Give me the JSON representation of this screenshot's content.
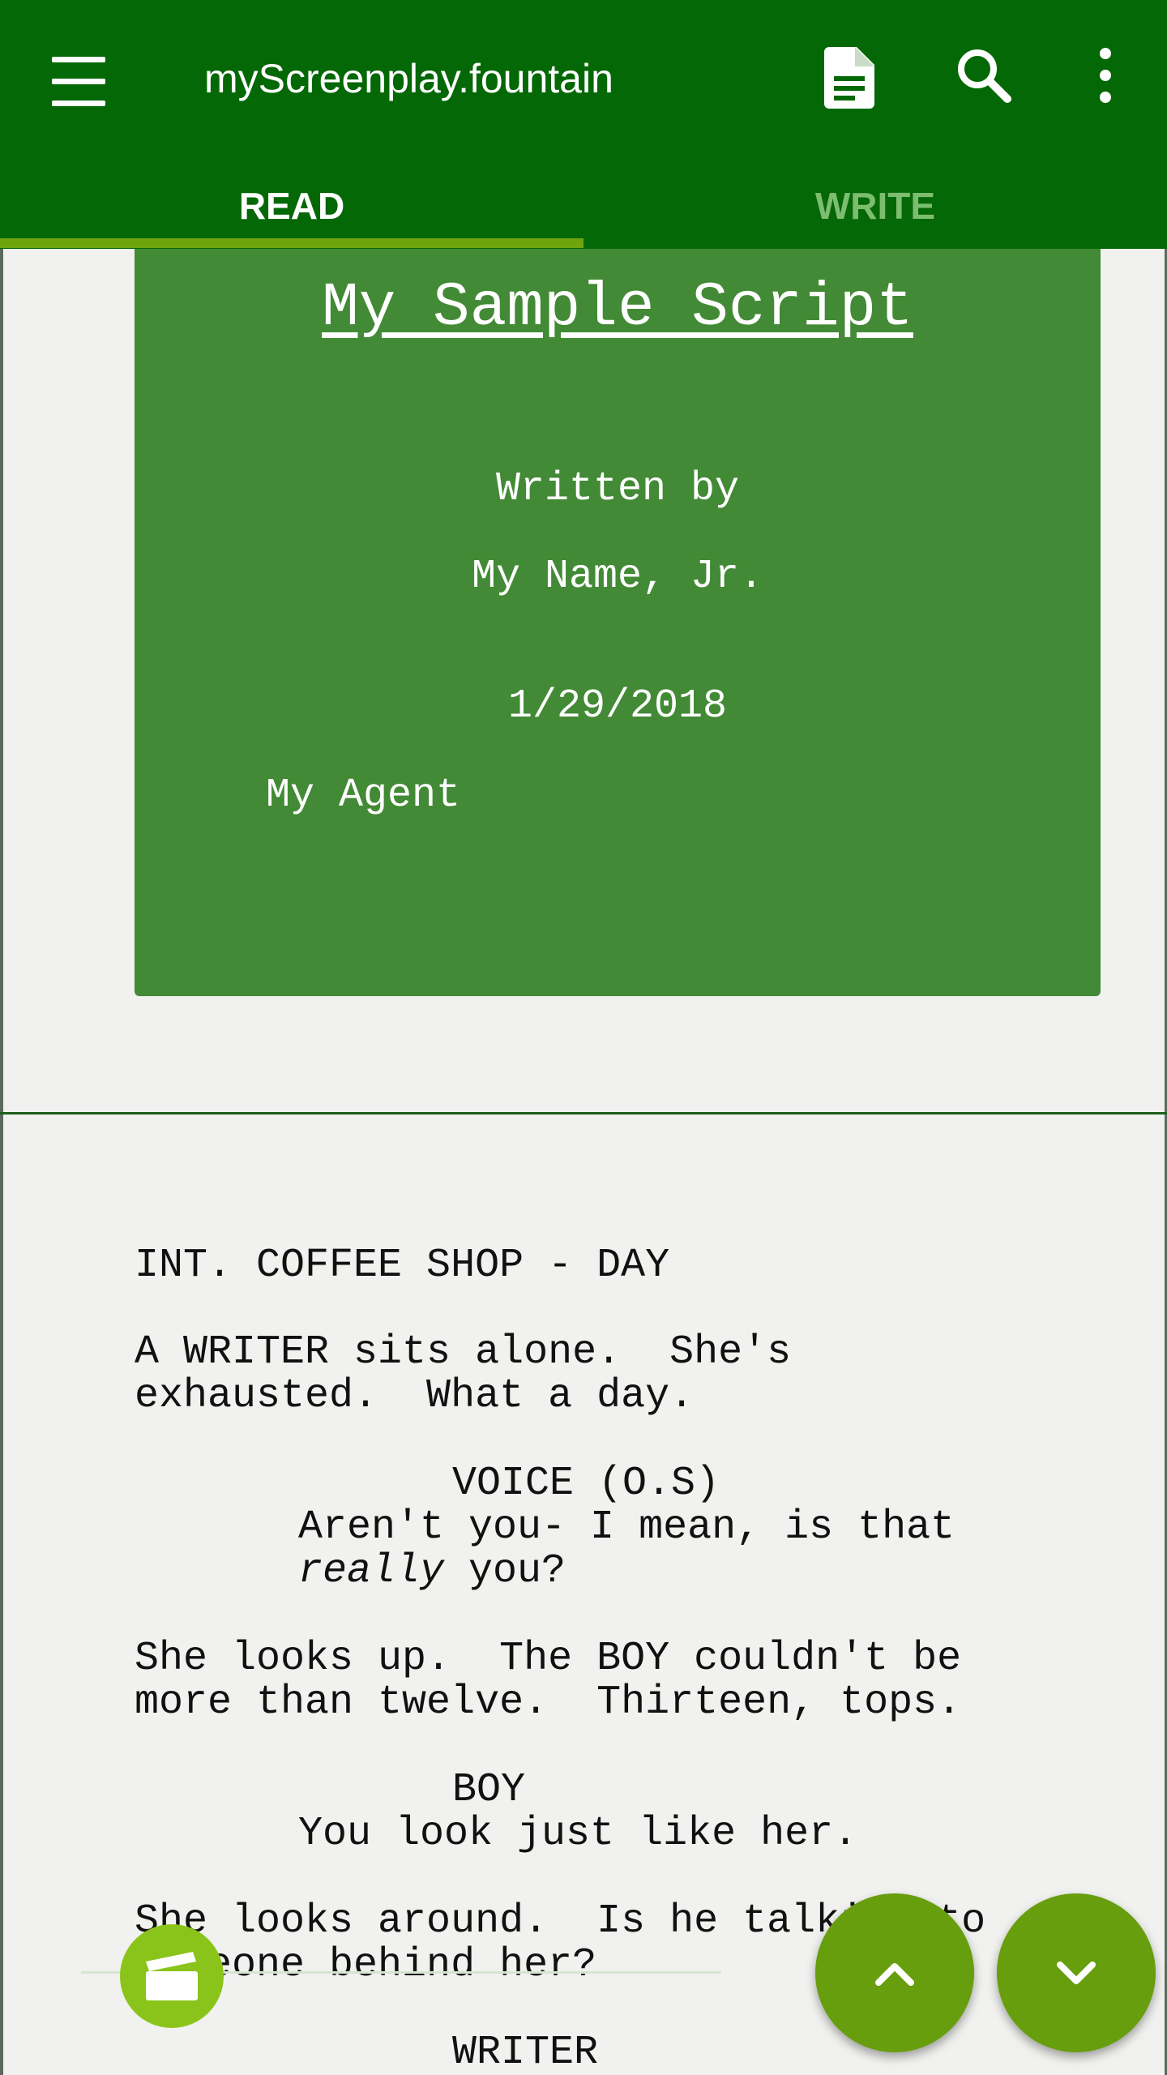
{
  "appbar": {
    "title": "myScreenplay.fountain",
    "icons": [
      "menu-icon",
      "document-icon",
      "search-icon",
      "more-vert-icon"
    ]
  },
  "tabs": [
    {
      "label": "READ",
      "selected": true
    },
    {
      "label": "WRITE",
      "selected": false
    }
  ],
  "title_page": {
    "title": "My Sample Script",
    "credit": "Written by",
    "author": "My Name, Jr.",
    "draft_date": "1/29/2018",
    "contact": "My Agent"
  },
  "script": {
    "scene_heading": "INT. COFFEE SHOP - DAY",
    "action_1": [
      "A WRITER sits alone.  She's",
      "exhausted.  What a day."
    ],
    "character_1": "VOICE (O.S)",
    "dialogue_1": [
      "Aren't you- I mean, is that",
      "really",
      " you?"
    ],
    "action_2": [
      "She looks up.  The BOY couldn't be",
      "more than twelve.  Thirteen, tops."
    ],
    "character_2": "BOY",
    "dialogue_2": "You look just like her.",
    "action_3": [
      "She looks around.  Is he talking to",
      "someone behind her?"
    ],
    "character_3": "WRITER"
  },
  "colors": {
    "appbar": "#056806",
    "tab_indicator": "#6fa40e",
    "title_card": "#428a35",
    "fab": "#679e0d",
    "clapper_button": "#8ac41a"
  }
}
